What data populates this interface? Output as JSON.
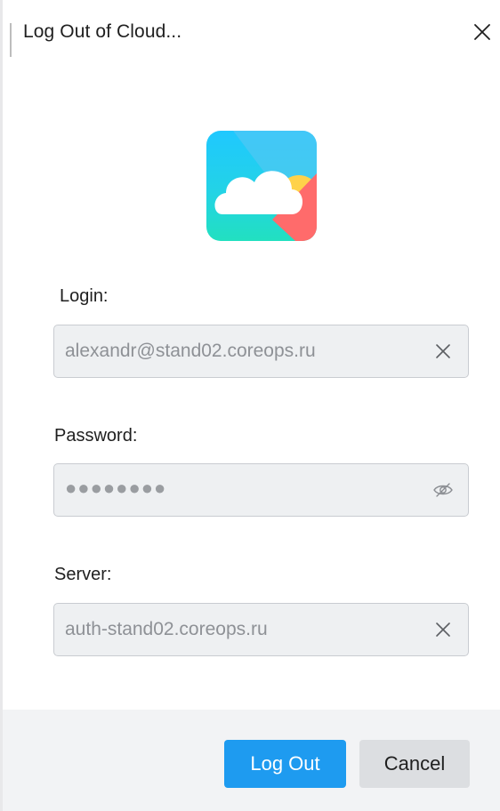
{
  "window": {
    "title": "Log Out of Cloud..."
  },
  "icons": {
    "close": "close-icon",
    "logo": "cloud-app-logo",
    "clear": "clear-icon",
    "toggle_password": "eye-slash-icon"
  },
  "form": {
    "login": {
      "label": "Login:",
      "value": "alexandr@stand02.coreops.ru"
    },
    "password": {
      "label": "Password:",
      "value": "●●●●●●●●"
    },
    "server": {
      "label": "Server:",
      "value": "auth-stand02.coreops.ru"
    }
  },
  "buttons": {
    "logout_label": "Log Out",
    "cancel_label": "Cancel"
  },
  "colors": {
    "primary": "#1e9bf0",
    "secondary_button": "#dcdee1",
    "field_bg": "#eef0f2",
    "footer_bg": "#f2f3f5"
  }
}
